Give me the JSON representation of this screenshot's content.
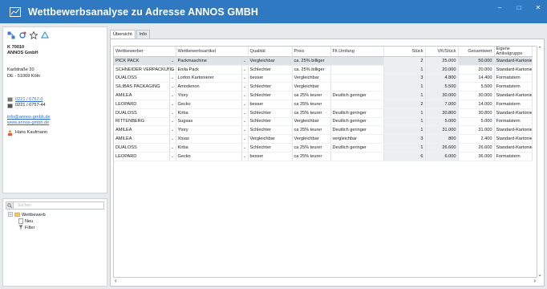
{
  "window": {
    "title": "Wettbewerbsanalyse zu Adresse ANNOS GMBH",
    "buttons": {
      "minimize": "–",
      "maximize": "□",
      "close": "✕"
    }
  },
  "contact": {
    "number": "K 70010",
    "company": "ANNOS GmbH",
    "street": "Karlstraße 20",
    "city": "DE - 51069 Köln",
    "phone": "0221 / 6757-0",
    "fax": "0221 / 6757-44",
    "email": "info@annos-gmbh.de",
    "website": "www.annos-gmbh.de",
    "person": "Hans Kaufmann"
  },
  "tree": {
    "search_placeholder": "Suchen",
    "root": "Wettbewerb",
    "children": [
      "Neu",
      "Filter"
    ]
  },
  "tabs": [
    "Übersicht",
    "Info"
  ],
  "table": {
    "columns": [
      "Wettbewerber",
      "Wettbewerbsartikel",
      "Qualität",
      "Preis",
      "Flt.Umfang",
      "Stück",
      "VK/Stück",
      "Gesamtwert",
      "Eigene Artikelgruppe"
    ],
    "rows": [
      [
        "PICK PACK",
        "Packmaschine",
        "Vergleichbar",
        "ca. 25% billiger",
        "",
        "2",
        "25.000",
        "50.000",
        "Standard-Kartonierer"
      ],
      [
        "SCHNEIDER VERPACKUNG",
        "Enila Pack",
        "Schlechter",
        "ca. 25% billiger",
        "",
        "1",
        "20.000",
        "20.000",
        "Standard-Kartonierer"
      ],
      [
        "DUALOSS",
        "Lorton Kartonierer",
        "besser",
        "Vergleichbar",
        "",
        "3",
        "4.800",
        "14.400",
        "Formatstern"
      ],
      [
        "SILIBAS PACKAGING",
        "Amodenon",
        "Schlechter",
        "Vergleichbar",
        "",
        "1",
        "5.500",
        "5.500",
        "Formatstern"
      ],
      [
        "AMILEA",
        "Ytory",
        "Schlechter",
        "ca 25% teurer",
        "Deutlich geringer",
        "1",
        "30.000",
        "30.000",
        "Standard-Kartonierer"
      ],
      [
        "LEOPARD",
        "Gecko",
        "besser",
        "ca 25% teurer",
        "",
        "2",
        "7.000",
        "14.000",
        "Formatstern"
      ],
      [
        "DUALOSS",
        "Kirba",
        "Schlechter",
        "ca 25% teurer",
        "Deutlich geringer",
        "1",
        "30.800",
        "30.800",
        "Standard-Kartonierer"
      ],
      [
        "RITTENBERG",
        "Sugsas",
        "Schlechter",
        "Vergleichbar",
        "Deutlich geringer",
        "1",
        "5.000",
        "5.000",
        "Formatstern"
      ],
      [
        "AMILEA",
        "Ytory",
        "Schlechter",
        "ca 25% teurer",
        "Deutlich geringer",
        "1",
        "31.000",
        "31.000",
        "Standard-Kartonierer"
      ],
      [
        "AMILEA",
        "Xtoas",
        "Vergleichbar",
        "Vergleichbar",
        "vergleichbar",
        "3",
        "800",
        "2.400",
        "Standard-Kartonierer"
      ],
      [
        "DUALOSS",
        "Kirba",
        "Schlechter",
        "ca 25% teurer",
        "Deutlich geringer",
        "1",
        "26.600",
        "26.600",
        "Standard-Kartonierer"
      ],
      [
        "LEOPARD",
        "Gecko",
        "besser",
        "ca 25% teurer",
        "",
        "6",
        "6.000",
        "36.000",
        "Formatstern"
      ]
    ]
  },
  "colors": {
    "titlebar": "#2f78c2",
    "selected_row": "#dfe3e7",
    "link": "#2a6fc9"
  }
}
